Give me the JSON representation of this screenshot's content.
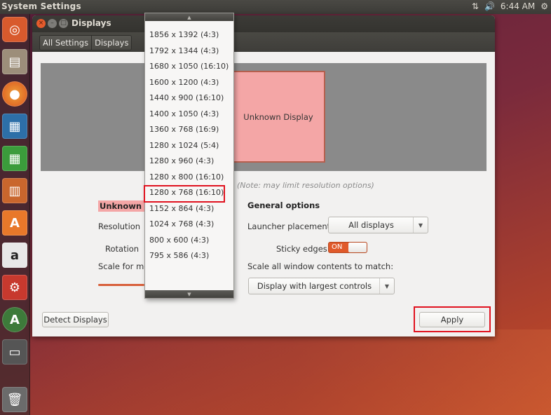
{
  "panel": {
    "app_title": "System Settings",
    "time": "6:44 AM",
    "network_icon": "network-updown-icon",
    "volume_icon": "volume-icon",
    "settings_icon": "gear-icon"
  },
  "launcher": {
    "items": [
      {
        "name": "ubuntu-dash",
        "glyph": "◎",
        "color": "#d85a2d"
      },
      {
        "name": "files",
        "glyph": "▤",
        "color": "#9c8e7a"
      },
      {
        "name": "firefox",
        "glyph": "●",
        "color": "#e66a1f"
      },
      {
        "name": "writer",
        "glyph": "▦",
        "color": "#2d6fa8"
      },
      {
        "name": "calc",
        "glyph": "▦",
        "color": "#3b9c3b"
      },
      {
        "name": "impress",
        "glyph": "▥",
        "color": "#c9662d"
      },
      {
        "name": "software-center",
        "glyph": "A",
        "color": "#e8782a"
      },
      {
        "name": "amazon",
        "glyph": "a",
        "color": "#e6e6e6"
      },
      {
        "name": "system-settings",
        "glyph": "⚙",
        "color": "#c7392e"
      },
      {
        "name": "software-updater",
        "glyph": "A",
        "color": "#4b4b4b"
      },
      {
        "name": "floppy-drive",
        "glyph": "▭",
        "color": "#555"
      },
      {
        "name": "trash",
        "glyph": "🗑",
        "color": "#6b6b6b"
      }
    ]
  },
  "window": {
    "title": "Displays",
    "breadcrumbs": [
      "All Settings",
      "Displays"
    ]
  },
  "preview": {
    "monitor_label": "Unknown Display"
  },
  "left_panel": {
    "section_title": "Unknown Di",
    "resolution_label": "Resolution",
    "rotation_label": "Rotation",
    "scale_label": "Scale for me"
  },
  "note": "(Note: may limit resolution options)",
  "general": {
    "title": "General options",
    "launcher_placement_label": "Launcher placement",
    "launcher_placement_value": "All displays",
    "sticky_edges_label": "Sticky edges",
    "sticky_edges_state": "ON",
    "scale_all_label": "Scale all window contents to match:",
    "scale_all_value": "Display with largest controls"
  },
  "buttons": {
    "detect": "Detect Displays",
    "apply": "Apply"
  },
  "resolution_menu": {
    "options": [
      "1856 x 1392 (4:3)",
      "1792 x 1344 (4:3)",
      "1680 x 1050 (16:10)",
      "1600 x 1200 (4:3)",
      "1440 x 900 (16:10)",
      "1400 x 1050 (4:3)",
      "1360 x 768 (16:9)",
      "1280 x 1024 (5:4)",
      "1280 x 960 (4:3)",
      "1280 x 800 (16:10)",
      "1280 x 768 (16:10)",
      "1152 x 864 (4:3)",
      "1024 x 768 (4:3)",
      "800 x 600 (4:3)",
      "795 x 586 (4:3)"
    ],
    "selected": "1280 x 768 (16:10)",
    "highlight_color": "#e0121f"
  }
}
